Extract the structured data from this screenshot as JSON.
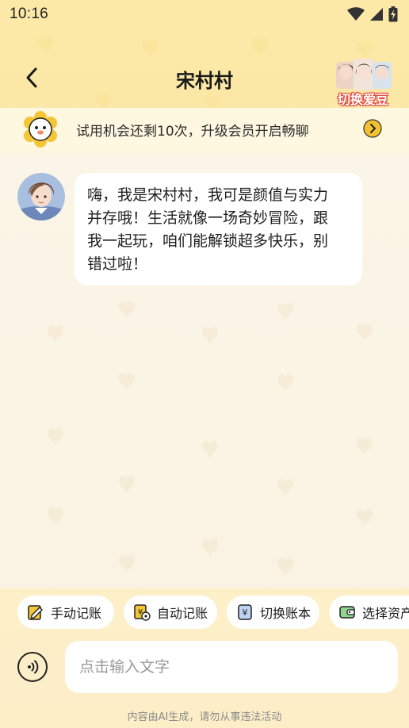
{
  "status_bar": {
    "time": "10:16",
    "icons": [
      "wifi-icon",
      "signal-icon",
      "battery-charging-icon"
    ]
  },
  "header": {
    "title": "宋村村",
    "back_icon": "chevron-left-icon",
    "switch_idol_label": "切换爱豆"
  },
  "trial_banner": {
    "text": "试用机会还剩10次，升级会员开启畅聊",
    "arrow_icon": "chevron-right-circle-icon",
    "accent_color": "#F2C230"
  },
  "chat": {
    "messages": [
      {
        "sender": "宋村村",
        "text": "嗨，我是宋村村，我可是颜值与实力\n并存哦！生活就像一场奇妙冒险，跟\n我一起玩，咱们能解锁超多快乐，别\n错过啦！"
      }
    ]
  },
  "quick_actions": [
    {
      "label": "手动记账",
      "icon": "edit-note-icon"
    },
    {
      "label": "自动记账",
      "icon": "auto-bill-icon"
    },
    {
      "label": "切换账本",
      "icon": "switch-book-icon"
    },
    {
      "label": "选择资产",
      "icon": "wallet-icon"
    }
  ],
  "input": {
    "placeholder": "点击输入文字",
    "voice_icon": "voice-wave-icon"
  },
  "footer": {
    "disclaimer": "内容由AI生成，请勿从事违法活动"
  },
  "colors": {
    "header_bg": "#FCE9A8",
    "chat_bg": "#FAF3E3",
    "bubble_bg": "#FFFFFF"
  }
}
